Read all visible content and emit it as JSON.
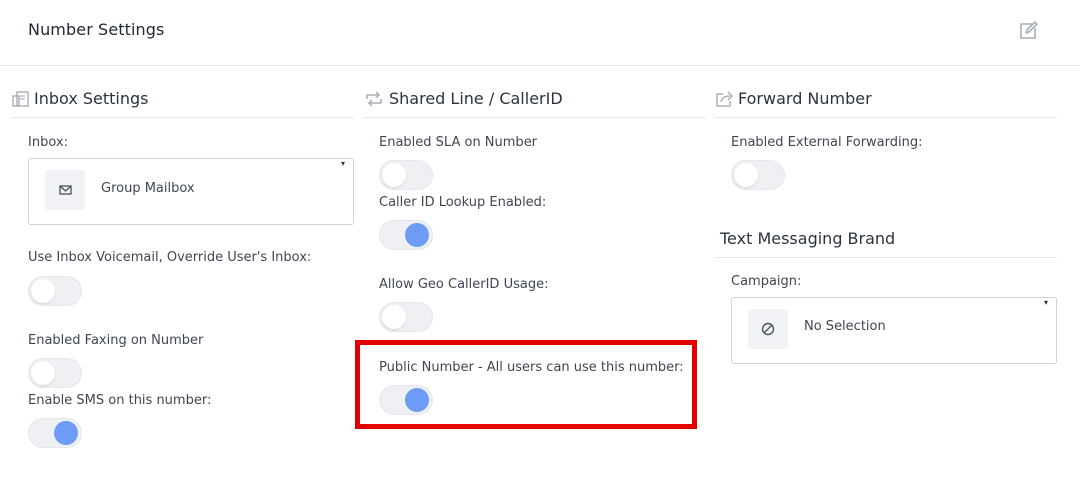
{
  "header": {
    "title": "Number Settings",
    "edit_icon": "edit-icon"
  },
  "inbox_settings": {
    "title": "Inbox Settings",
    "icon": "mailbox-icon",
    "inbox_label": "Inbox:",
    "inbox_value": "Group Mailbox",
    "inbox_value_icon": "mail-icon",
    "voicemail_label": "Use Inbox Voicemail, Override User's Inbox:",
    "voicemail_on": false,
    "faxing_label": "Enabled Faxing on Number",
    "faxing_on": false,
    "sms_label": "Enable SMS on this number:",
    "sms_on": true
  },
  "shared_line": {
    "title": "Shared Line / CallerID",
    "icon": "repeat-icon",
    "sla_label": "Enabled SLA on Number",
    "sla_on": false,
    "callerid_lookup_label": "Caller ID Lookup Enabled:",
    "callerid_lookup_on": true,
    "geo_callerid_label": "Allow Geo CallerID Usage:",
    "geo_callerid_on": false,
    "public_number_label": "Public Number - All users can use this number:",
    "public_number_on": true
  },
  "forward_number": {
    "title": "Forward Number",
    "icon": "share-icon",
    "external_forwarding_label": "Enabled External Forwarding:",
    "external_forwarding_on": false
  },
  "text_messaging": {
    "title": "Text Messaging Brand",
    "campaign_label": "Campaign:",
    "campaign_value": "No Selection",
    "campaign_value_icon": "ban-icon"
  },
  "colors": {
    "toggle_on": "#6e9bf5",
    "highlight": "#e30000"
  }
}
